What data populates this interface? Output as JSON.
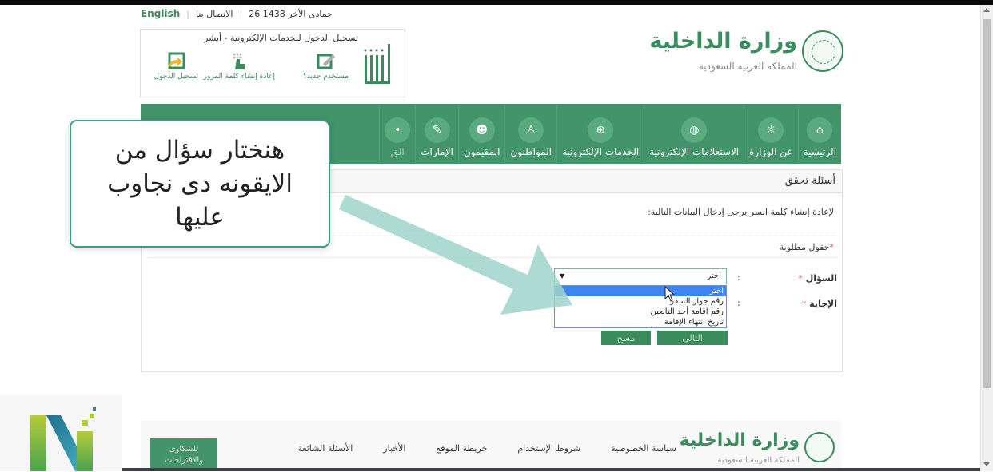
{
  "top_links": {
    "english": "English",
    "contact": "الاتصال بنا",
    "date": "26 جمادى الأخر 1438"
  },
  "absher": {
    "title": "تسجيل الدخول للخدمات الإلكترونية - أبشر",
    "logo_text": "أبشر",
    "items": [
      {
        "label": "مستخدم جديد؟",
        "icon": "pencil-box-icon"
      },
      {
        "label": "إعادة إنشاء كلمة المرور",
        "icon": "keypad-finger-icon"
      },
      {
        "label": "تسجيل الدخول",
        "icon": "login-arrow-icon"
      }
    ]
  },
  "header_logo": {
    "name": "وزارة الداخلية",
    "subtitle": "المملكة العربية السعودية"
  },
  "nav": {
    "items": [
      {
        "label": "الرئيسية",
        "icon": "home-icon",
        "glyph": "⌂"
      },
      {
        "label": "عن الوزارة",
        "icon": "emblem-icon",
        "glyph": "☼"
      },
      {
        "label": "الاستعلامات الإلكترونية",
        "icon": "globe-map-icon",
        "glyph": "◍"
      },
      {
        "label": "الخدمات الإلكترونية",
        "icon": "globe-icon",
        "glyph": "⊕"
      },
      {
        "label": "المواطنون",
        "icon": "citizen-icon",
        "glyph": "♙"
      },
      {
        "label": "المقيمون",
        "icon": "residents-icon",
        "glyph": "☻"
      },
      {
        "label": "الإمارات",
        "icon": "emirates-icon",
        "glyph": "✎"
      },
      {
        "label": "الق",
        "icon": "nav-icon",
        "glyph": "•"
      }
    ]
  },
  "panel": {
    "title": "أسئلة تحقق",
    "instructions": "لإعادة إنشاء كلمة السر يرجى إدخال البيانات التالية:",
    "required_note": "حقول مطلوبة",
    "required_star": "*"
  },
  "form": {
    "question_label": "السؤال",
    "answer_label": "الإجابة",
    "colon": ":",
    "star": "*",
    "select_value": "اختر",
    "caret": "▼",
    "options": [
      {
        "label": "اختر",
        "selected": true
      },
      {
        "label": "رقم جواز السفر",
        "selected": false
      },
      {
        "label": "رقم اقامة أحد التابعين",
        "selected": false
      },
      {
        "label": "تاريخ انتهاء الإقامة",
        "selected": false
      }
    ],
    "next_button": "التالي",
    "clear_button": "مسح"
  },
  "callout": {
    "line1": "هنختار سؤال من",
    "line2": "الايقونه دى نجاوب",
    "line3": "عليها"
  },
  "footer": {
    "logo_name": "وزارة الداخلية",
    "logo_sub": "المملكة العربية السعودية",
    "links": [
      "سياسة الخصوصية",
      "شروط الإستخدام",
      "خريطة الموقع",
      "الأخبار",
      "الأسئلة الشائعة"
    ],
    "complaints_line1": "للشكاوى",
    "complaints_line2": "والإقتراحات"
  },
  "colors": {
    "brand_green": "#43946a",
    "callout_border": "#3b9c8c",
    "arrow": "#9fd3cb",
    "selected_option": "#3f85f0"
  }
}
